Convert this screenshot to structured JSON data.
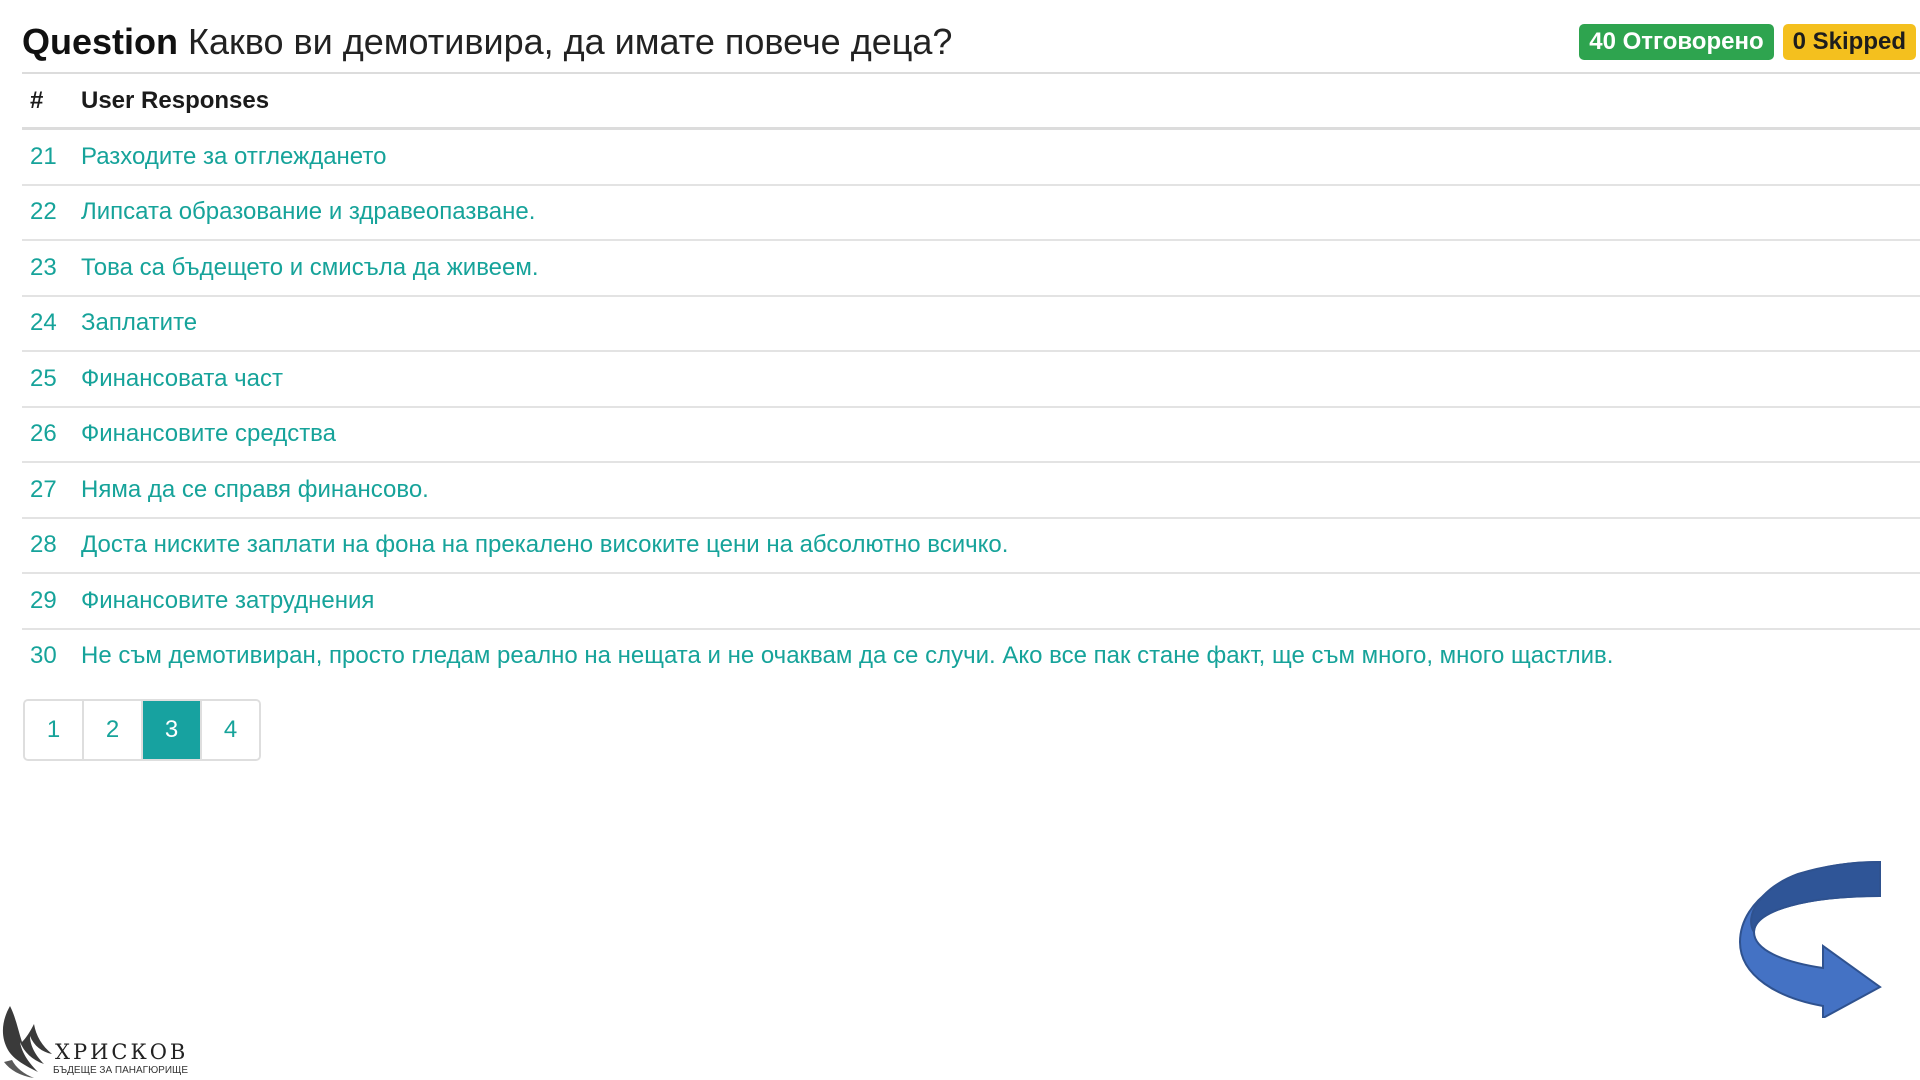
{
  "question": {
    "label": "Question",
    "text": "Какво ви демотивира, да имате повече деца?"
  },
  "badges": {
    "answered": "40 Отговорено",
    "skipped": "0 Skipped"
  },
  "table": {
    "headers": [
      "#",
      "User Responses"
    ],
    "rows": [
      {
        "num": "21",
        "text": "Разходите за отглеждането"
      },
      {
        "num": "22",
        "text": "Липсата образование и здравеопазване."
      },
      {
        "num": "23",
        "text": "Това са бъдещето и смисъла да живеем."
      },
      {
        "num": "24",
        "text": "Заплатите"
      },
      {
        "num": "25",
        "text": "Финансовата част"
      },
      {
        "num": "26",
        "text": "Финансовите средства"
      },
      {
        "num": "27",
        "text": "Няма да се справя финансово."
      },
      {
        "num": "28",
        "text": "Доста ниските заплати на фона на прекалено високите цени на абсолютно всичко."
      },
      {
        "num": "29",
        "text": "Финансовите затруднения"
      },
      {
        "num": "30",
        "text": "Не съм демотивиран, просто гледам реално на нещата и не очаквам да се случи. Ако все пак стане факт, ще съм много, много щастлив."
      }
    ]
  },
  "pagination": {
    "pages": [
      "1",
      "2",
      "3",
      "4"
    ],
    "active": "3"
  },
  "logo": {
    "name": "ХРИСКОВ",
    "tagline": "БЪДЕЩЕ ЗА ПАНАГЮРИЩЕ"
  },
  "icons": {
    "next_arrow": "curved-arrow-icon",
    "logo_mark": "eagle-logo-icon"
  },
  "colors": {
    "accent": "#17a2a0",
    "response_text": "#16a39a",
    "answered_badge": "#2ea44f",
    "skipped_badge": "#f4c01e",
    "arrow_fill": "#4472c4"
  }
}
